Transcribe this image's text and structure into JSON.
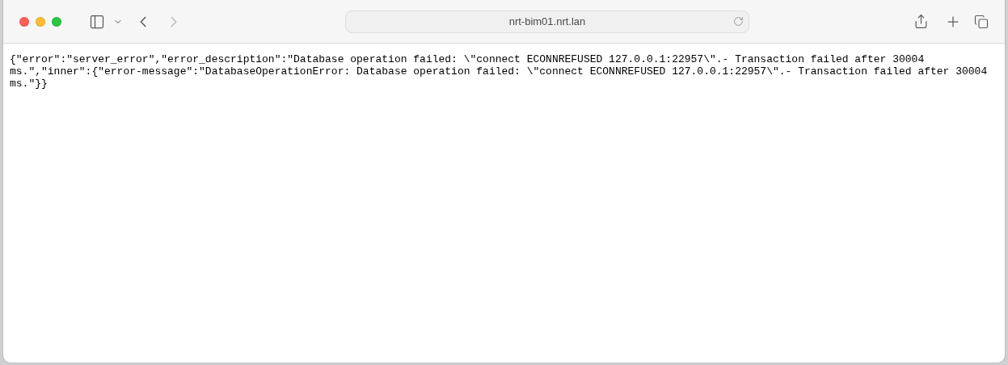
{
  "address_bar": {
    "url": "nrt-bim01.nrt.lan"
  },
  "navigation": [
    {
      "kind": "back",
      "disabled": false
    },
    {
      "kind": "forward",
      "disabled": true
    }
  ],
  "page": {
    "text": "{\"error\":\"server_error\",\"error_description\":\"Database operation failed: \\\"connect ECONNREFUSED 127.0.0.1:22957\\\".- Transaction failed after 30004 ms.\",\"inner\":{\"error-message\":\"DatabaseOperationError: Database operation failed: \\\"connect ECONNREFUSED 127.0.0.1:22957\\\".- Transaction failed after 30004 ms.\"}}"
  }
}
